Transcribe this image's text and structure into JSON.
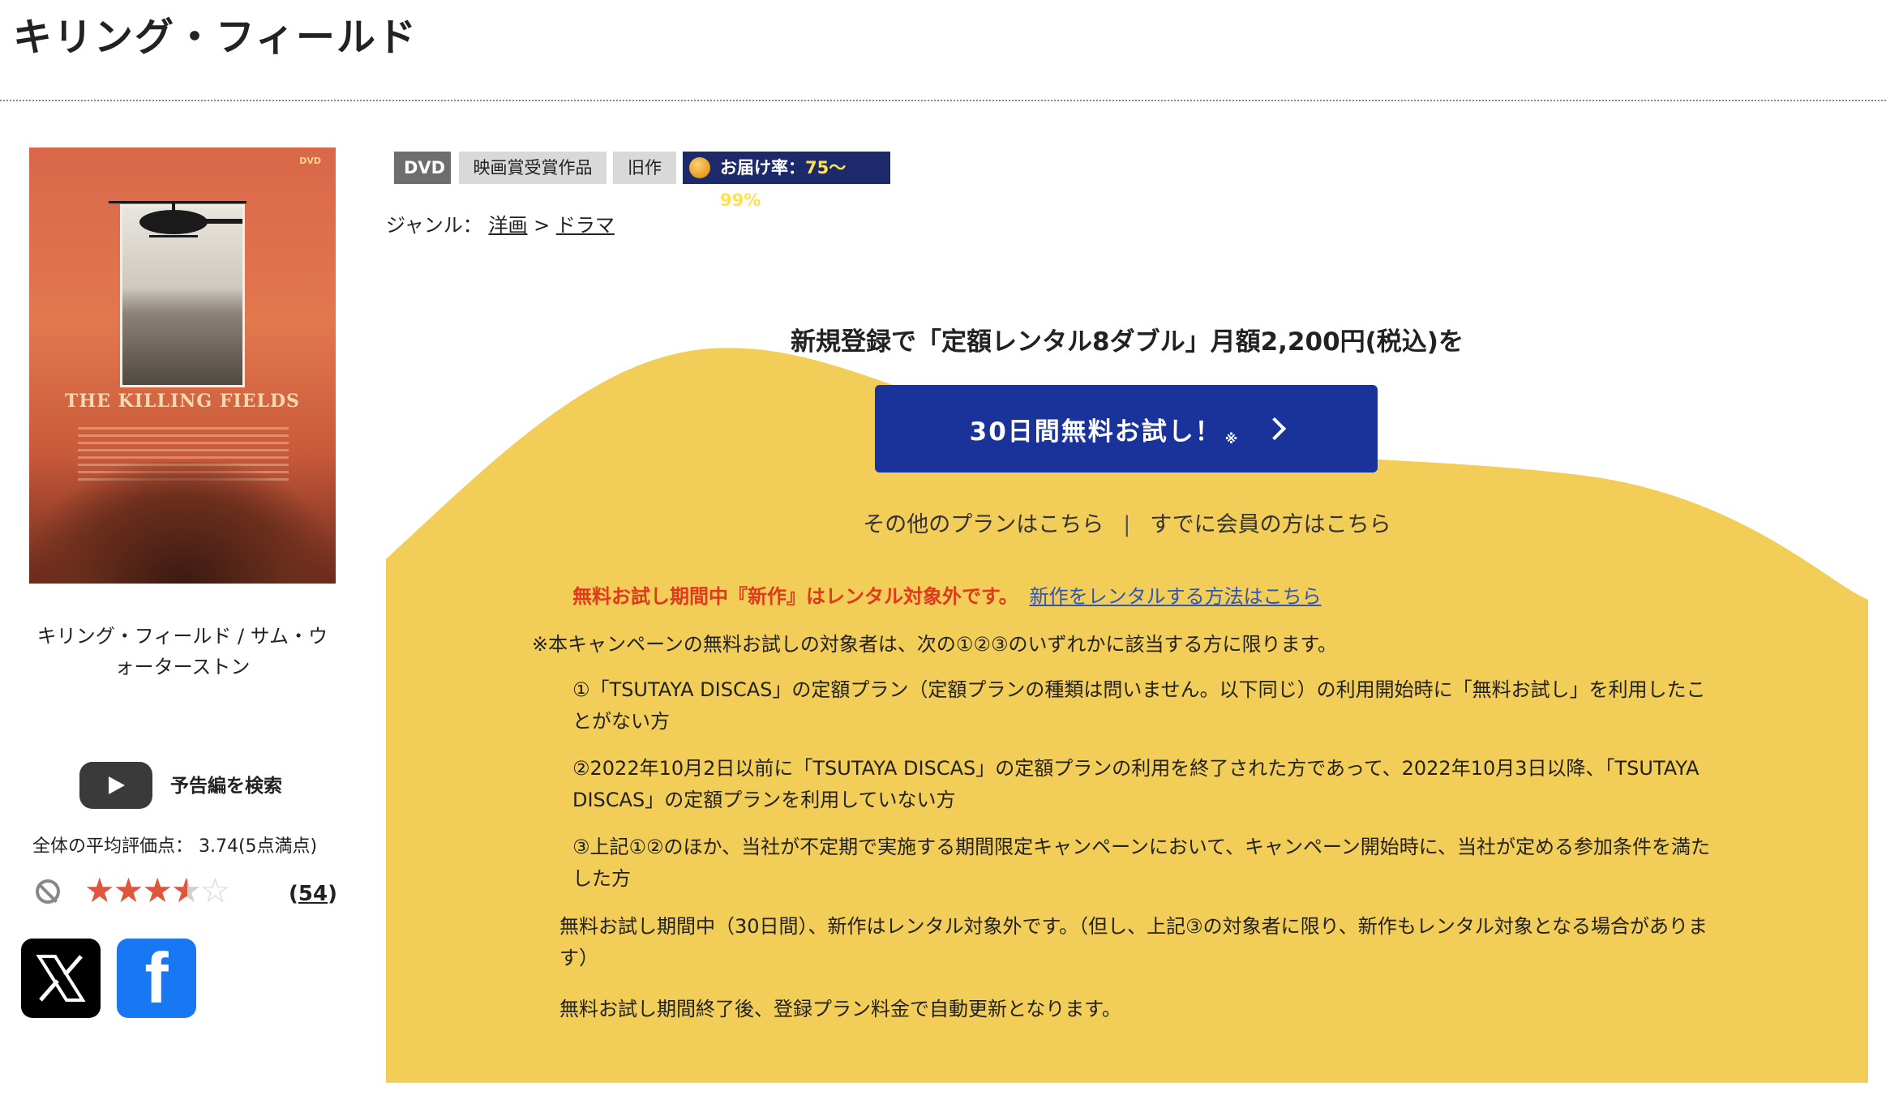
{
  "page": {
    "title": "キリング・フィールド"
  },
  "poster": {
    "film_title": "THE KILLING FIELDS",
    "dvd_mark": "DVD",
    "caption": "キリング・フィールド / サム・ウォーターストン"
  },
  "trailer": {
    "label": "予告編を検索"
  },
  "rating": {
    "summary": "全体の平均評価点： 3.74(5点満点)",
    "value": 3.74,
    "max": 5,
    "count": "54",
    "count_open": "(",
    "count_close": ")"
  },
  "social": {
    "x_icon": "x-logo-icon",
    "facebook_icon": "facebook-f-icon",
    "facebook_glyph": "f"
  },
  "badges": {
    "format": "DVD",
    "award": "映画賞受賞作品",
    "age": "旧作",
    "delivery_label": "お届け率：",
    "delivery_rate": "75〜99%"
  },
  "genre": {
    "label": "ジャンル：",
    "parent": "洋画",
    "separator": ">",
    "child": "ドラマ"
  },
  "promo": {
    "headline": "新規登録で「定額レンタル8ダブル」月額2,200円(税込)を",
    "button_label": "30日間無料お試し！",
    "button_mark": "※",
    "other_plans": "その他のプランはこちら",
    "link_separator": "|",
    "members": "すでに会員の方はこちら",
    "notice_red": "無料お試し期間中『新作』はレンタル対象外です。",
    "notice_link": "新作をレンタルする方法はこちら",
    "campaign_intro": "※本キャンペーンの無料お試しの対象者は、次の①②③のいずれかに該当する方に限ります。",
    "conditions": [
      "①「TSUTAYA DISCAS」の定額プラン（定額プランの種類は問いません。以下同じ）の利用開始時に「無料お試し」を利用したことがない方",
      "②2022年10月2日以前に「TSUTAYA DISCAS」の定額プランの利用を終了された方であって、2022年10月3日以降、「TSUTAYA DISCAS」の定額プランを利用していない方",
      "③上記①②のほか、当社が不定期で実施する期間限定キャンペーンにおいて、キャンペーン開始時に、当社が定める参加条件を満たした方"
    ],
    "trial_note": "無料お試し期間中（30日間）、新作はレンタル対象外です。（但し、上記③の対象者に限り、新作もレンタル対象となる場合があります）",
    "renew_note": "無料お試し期間終了後、登録プラン料金で自動更新となります。"
  },
  "colors": {
    "promo_yellow": "#f2cd57",
    "button_blue": "#19339a",
    "notice_red": "#e03a1e",
    "link_blue": "#2f56b5",
    "star_color": "#e0553b",
    "delivery_badge": "#1c2a6b"
  }
}
